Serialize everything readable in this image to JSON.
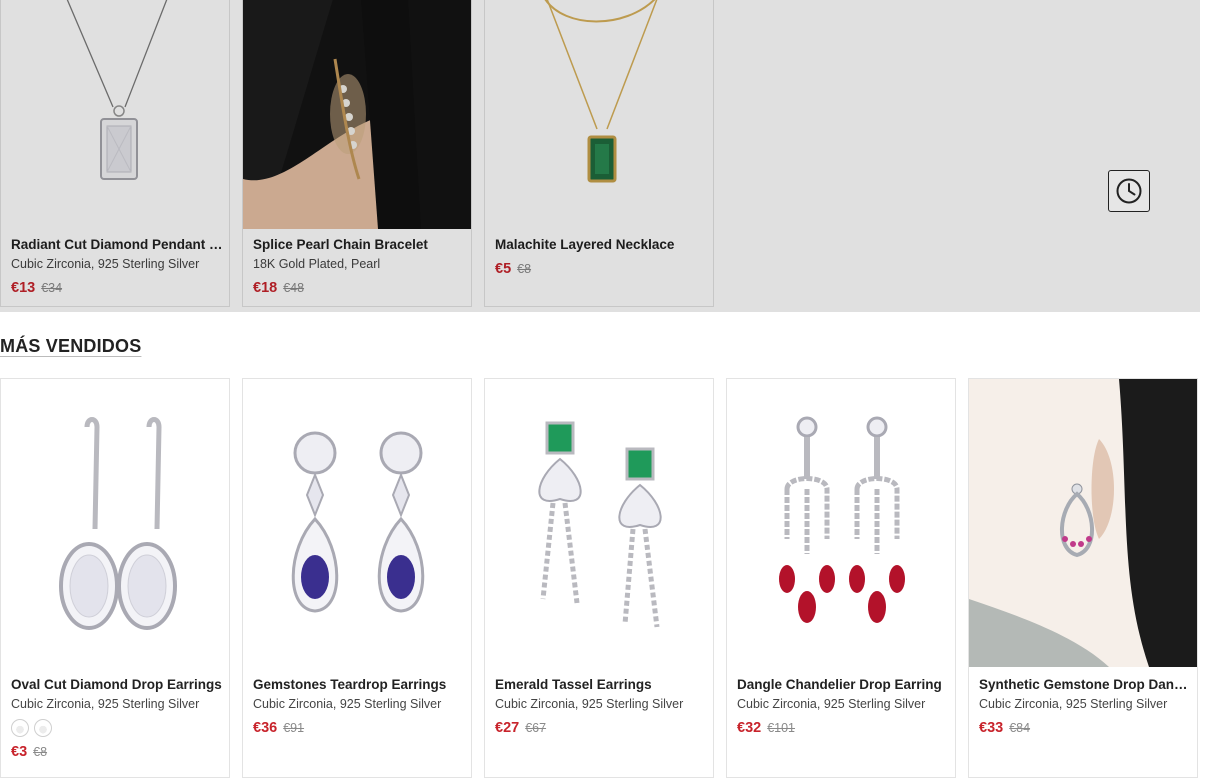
{
  "recently_viewed": [
    {
      "title": "Radiant Cut Diamond Pendant Necklace",
      "material": "Cubic Zirconia, 925 Sterling Silver",
      "price": "€13",
      "old_price": "€34"
    },
    {
      "title": "Splice Pearl Chain Bracelet",
      "material": "18K Gold Plated, Pearl",
      "price": "€18",
      "old_price": "€48"
    },
    {
      "title": "Malachite Layered Necklace",
      "material": "",
      "price": "€5",
      "old_price": "€8"
    }
  ],
  "history_button": {
    "icon": "clock-icon"
  },
  "best_sellers": {
    "heading": "MÁS VENDIDOS",
    "products": [
      {
        "title": "Oval Cut Diamond Drop Earrings",
        "material": "Cubic Zirconia, 925 Sterling Silver",
        "price": "€3",
        "old_price": "€8",
        "swatches": [
          "earring-variant-1",
          "earring-variant-2"
        ]
      },
      {
        "title": "Gemstones Teardrop Earrings",
        "material": "Cubic Zirconia, 925 Sterling Silver",
        "price": "€36",
        "old_price": "€91"
      },
      {
        "title": "Emerald Tassel Earrings",
        "material": "Cubic Zirconia, 925 Sterling Silver",
        "price": "€27",
        "old_price": "€67"
      },
      {
        "title": "Dangle Chandelier Drop Earring",
        "material": "Cubic Zirconia, 925 Sterling Silver",
        "price": "€32",
        "old_price": "€101"
      },
      {
        "title": "Synthetic Gemstone Drop Dangle Earrings",
        "material": "Cubic Zirconia, 925 Sterling Silver",
        "price": "€33",
        "old_price": "€84"
      }
    ]
  },
  "colors": {
    "price": "#c8242c",
    "old_price": "#8a8a8a",
    "emerald": "#1f9a5a",
    "sapphire": "#3a2f8f",
    "ruby": "#b3122a"
  }
}
